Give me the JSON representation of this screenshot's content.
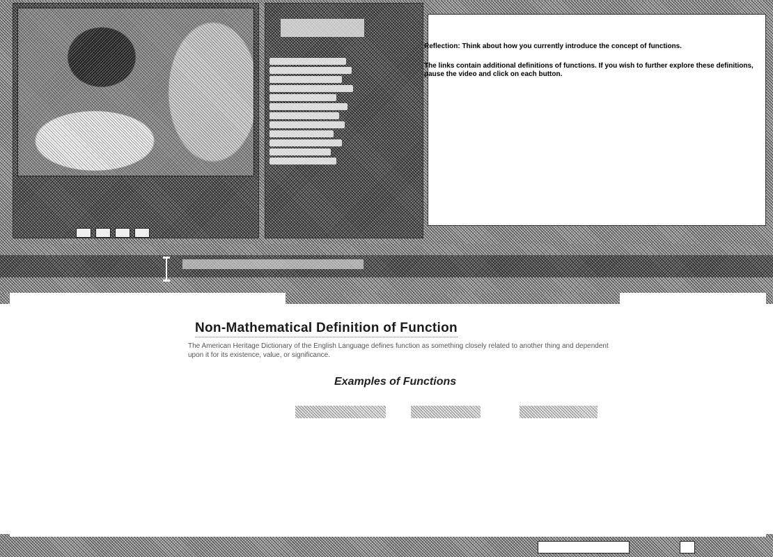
{
  "reflection": {
    "line1": "Reflection: Think about how you currently introduce the concept of functions.",
    "line2": "The links contain additional definitions of functions.  If you wish to further explore these definitions, pause the video and click on each button."
  },
  "content": {
    "title": "Non-Mathematical Definition of Function",
    "definition": "The American Heritage Dictionary of the English Language defines function as something closely related to another thing and dependent upon it for its existence, value, or significance.",
    "examples_heading": "Examples of Functions"
  },
  "icons": {
    "cursor": "text-cursor-icon"
  }
}
